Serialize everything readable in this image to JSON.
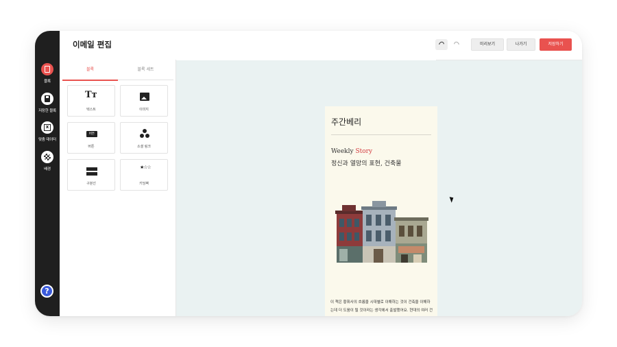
{
  "header": {
    "title": "이메일 편집",
    "preview_label": "미리보기",
    "exit_label": "나가기",
    "save_label": "저장하기"
  },
  "rail": {
    "items": [
      {
        "label": "블록",
        "icon": "block-icon",
        "active": true
      },
      {
        "label": "저장한 블록",
        "icon": "saved-block-icon"
      },
      {
        "label": "맞춤 데이터",
        "icon": "custom-data-icon"
      },
      {
        "label": "배경",
        "icon": "background-icon"
      }
    ],
    "help_label": "?"
  },
  "panel": {
    "tabs": [
      {
        "label": "블록",
        "active": true
      },
      {
        "label": "블록 세트"
      }
    ],
    "blocks": [
      {
        "label": "텍스트",
        "icon": "text-icon",
        "glyph": "Tт"
      },
      {
        "label": "이미지",
        "icon": "image-icon"
      },
      {
        "label": "버튼",
        "icon": "button-icon",
        "glyph": "버튼"
      },
      {
        "label": "소셜 링크",
        "icon": "social-link-icon"
      },
      {
        "label": "구분선",
        "icon": "divider-icon"
      },
      {
        "label": "키딩팩",
        "icon": "sticker-icon",
        "glyph": "★☆☆"
      }
    ]
  },
  "email": {
    "title": "주간베리",
    "kicker_a": "Weekly ",
    "kicker_b": "Story",
    "subtitle": "정신과 열망의 표현, 건축물",
    "body": "이 책은 황휘사의 흐름을 시대별로 이해하는 것이 건축을 이해하는데 더 도움이 될 것이라는 생각에서 출발했어요. 현대의 여러 건축들도 과거로부터 이어져 왔기",
    "accent_color": "#d33b40"
  },
  "colors": {
    "accent": "#e9524f",
    "rail": "#1f1f1f",
    "canvas": "#eaf2f2",
    "email_bg": "#fbf9ec"
  }
}
